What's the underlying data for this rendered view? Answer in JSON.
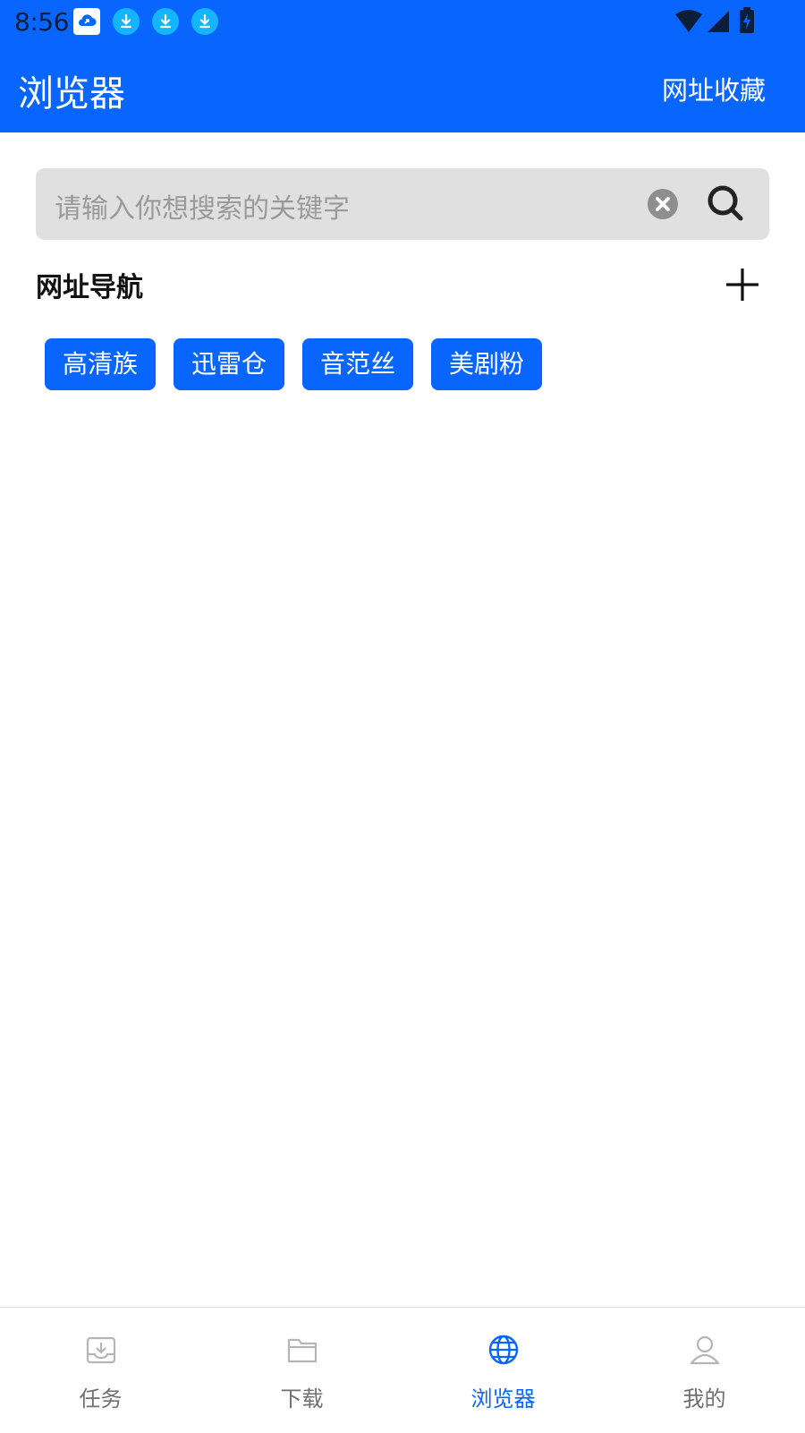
{
  "status_bar": {
    "time": "8:56",
    "notification_icons": [
      "cloud-app-icon",
      "download-icon",
      "download-icon",
      "download-icon"
    ],
    "system_icons": [
      "wifi-icon",
      "cellular-signal-icon",
      "battery-charging-icon"
    ]
  },
  "app_bar": {
    "title": "浏览器",
    "action_label": "网址收藏"
  },
  "search": {
    "placeholder": "请输入你想搜索的关键字",
    "clear_icon": "clear-circle-icon",
    "search_icon": "search-icon"
  },
  "nav_section": {
    "title": "网址导航",
    "add_icon": "plus-icon",
    "sites": [
      {
        "label": "高清族"
      },
      {
        "label": "迅雷仓"
      },
      {
        "label": "音范丝"
      },
      {
        "label": "美剧粉"
      }
    ]
  },
  "bottom_nav": {
    "items": [
      {
        "label": "任务",
        "icon": "inbox-download-icon",
        "active": false
      },
      {
        "label": "下载",
        "icon": "folder-icon",
        "active": false
      },
      {
        "label": "浏览器",
        "icon": "globe-icon",
        "active": true
      },
      {
        "label": "我的",
        "icon": "person-icon",
        "active": false
      }
    ]
  },
  "colors": {
    "primary": "#0866ff",
    "search_bg": "#e0e0e0",
    "inactive_nav": "#6f6f6f"
  }
}
